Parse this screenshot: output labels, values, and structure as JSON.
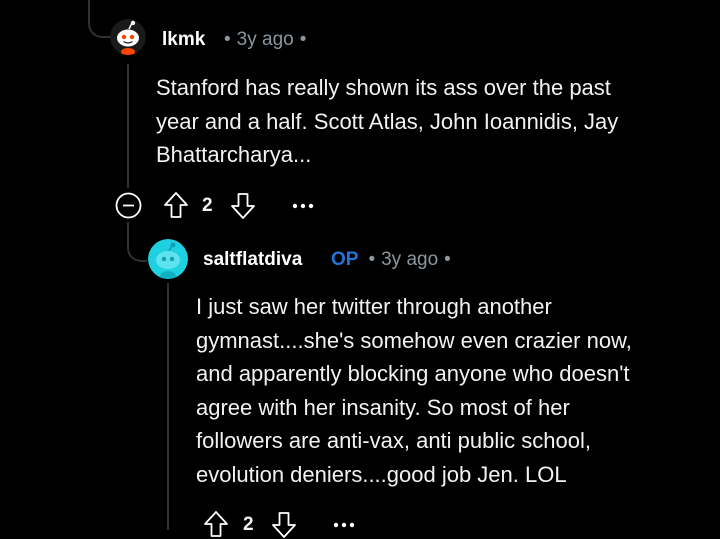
{
  "comments": [
    {
      "username": "lkmk",
      "time": "3y ago",
      "separator": "•",
      "body_lines": [
        "Stanford has really shown its ass over the past",
        "year and a half. Scott Atlas, John Ioannidis, Jay",
        "Bhattarcharya..."
      ],
      "vote_count": "2",
      "more_label": "•••",
      "avatar_icon": "reddit-snoo-avatar-icon"
    },
    {
      "username": "saltflatdiva",
      "op_badge": "OP",
      "time": "3y ago",
      "separator": "•",
      "body_lines": [
        "I just saw her twitter through another",
        "gymnast....she's somehow even crazier now,",
        "and apparently blocking anyone who doesn't",
        "agree with her insanity. So most of her",
        "followers are anti-vax, anti public school,",
        "evolution deniers....good job Jen. LOL"
      ],
      "vote_count": "2",
      "more_label": "•••",
      "avatar_icon": "reddit-snoo-avatar-icon"
    }
  ],
  "colors": {
    "background": "#000000",
    "thread_line": "#2d3237",
    "meta_text": "#8b969e",
    "op_badge": "#2473d6",
    "avatar_teal": "#1fd1e0"
  }
}
